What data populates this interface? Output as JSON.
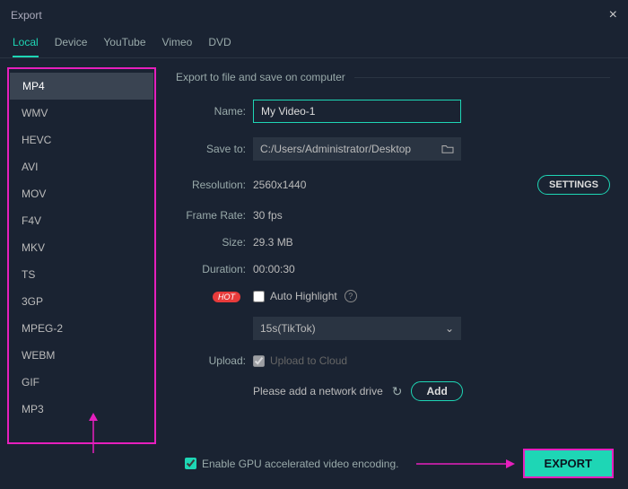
{
  "window": {
    "title": "Export"
  },
  "tabs": [
    "Local",
    "Device",
    "YouTube",
    "Vimeo",
    "DVD"
  ],
  "tabs_active": 0,
  "formats": [
    "MP4",
    "WMV",
    "HEVC",
    "AVI",
    "MOV",
    "F4V",
    "MKV",
    "TS",
    "3GP",
    "MPEG-2",
    "WEBM",
    "GIF",
    "MP3"
  ],
  "formats_selected": "MP4",
  "section_title": "Export to file and save on computer",
  "fields": {
    "name_label": "Name:",
    "name_value": "My Video-1",
    "saveto_label": "Save to:",
    "saveto_value": "C:/Users/Administrator/Desktop",
    "resolution_label": "Resolution:",
    "resolution_value": "2560x1440",
    "framerate_label": "Frame Rate:",
    "framerate_value": "30 fps",
    "size_label": "Size:",
    "size_value": "29.3 MB",
    "duration_label": "Duration:",
    "duration_value": "00:00:30",
    "settings_btn": "SETTINGS",
    "hot_badge": "HOT",
    "autohighlight_label": "Auto Highlight",
    "select_value": "15s(TikTok)",
    "upload_label": "Upload:",
    "upload_checkbox": "Upload to Cloud",
    "netdrive_text": "Please add a network drive",
    "add_btn": "Add"
  },
  "footer": {
    "gpu_label": "Enable GPU accelerated video encoding.",
    "export_btn": "EXPORT"
  }
}
